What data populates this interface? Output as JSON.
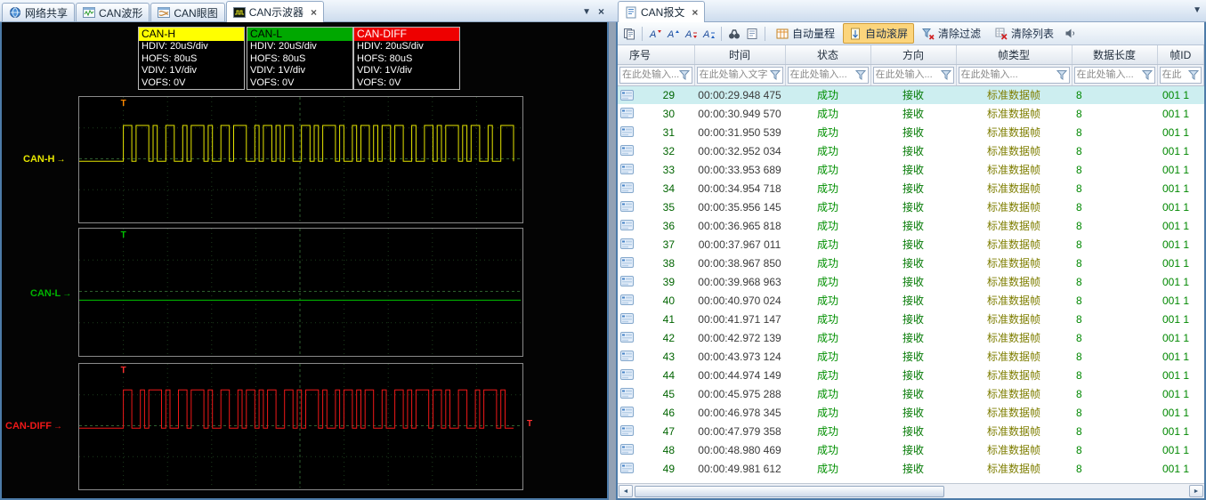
{
  "left_pane": {
    "tabs": [
      {
        "label": "网络共享",
        "icon": "network-icon"
      },
      {
        "label": "CAN波形",
        "icon": "waveform-icon"
      },
      {
        "label": "CAN眼图",
        "icon": "eye-diagram-icon"
      },
      {
        "label": "CAN示波器",
        "icon": "oscilloscope-icon",
        "active": true
      }
    ],
    "channel_info": [
      {
        "name": "CAN-H",
        "header_bg": "#ffff00",
        "header_fg": "#000000",
        "lines": [
          "HDIV: 20uS/div",
          "HOFS: 80uS",
          "VDIV: 1V/div",
          "VOFS: 0V"
        ]
      },
      {
        "name": "CAN-L",
        "header_bg": "#00a800",
        "header_fg": "#000000",
        "lines": [
          "HDIV: 20uS/div",
          "HOFS: 80uS",
          "VDIV: 1V/div",
          "VOFS: 0V"
        ]
      },
      {
        "name": "CAN-DIFF",
        "header_bg": "#ee0000",
        "header_fg": "#ffffff",
        "lines": [
          "HDIV: 20uS/div",
          "HOFS: 80uS",
          "VDIV: 1V/div",
          "VOFS: 0V"
        ]
      }
    ],
    "scopes": [
      {
        "label": "CAN-H",
        "type": "digital",
        "trace_color": "#e6e600",
        "label_color": "#e6e600",
        "trigger_color": "#ff8800",
        "idle_level": 0.52,
        "high_level": 0.23,
        "start": 0.1,
        "bits": "11011101001100101110100110111001011010110011010111010010110101101100100110101110101100100111"
      },
      {
        "label": "CAN-L",
        "type": "flat",
        "trace_color": "#00c400",
        "label_color": "#00b400",
        "trigger_color": "#00c400",
        "level": 0.57,
        "start": 0.1
      },
      {
        "label": "CAN-DIFF",
        "type": "digital",
        "trace_color": "#f01818",
        "label_color": "#f01818",
        "trigger_color": "#ff3030",
        "idle_level": 0.52,
        "high_level": 0.21,
        "start": 0.1,
        "bits": "11001011101001101110100110010110101100110101110100101101011001001101011101101001100101110100"
      }
    ]
  },
  "right_pane": {
    "tab": {
      "label": "CAN报文",
      "icon": "message-icon"
    },
    "toolbar": {
      "buttons": [
        {
          "label": "自动量程",
          "icon": "auto-range-icon",
          "active": false
        },
        {
          "label": "自动滚屏",
          "icon": "auto-scroll-icon",
          "active": true
        },
        {
          "label": "清除过滤",
          "icon": "clear-filter-icon",
          "active": false
        },
        {
          "label": "清除列表",
          "icon": "clear-list-icon",
          "active": false
        }
      ],
      "icons": [
        "copy-icon",
        "filter-a-1-icon",
        "filter-a-2-icon",
        "filter-a-3-icon",
        "filter-a-4-icon",
        "binoculars-icon",
        "notes-icon",
        "speaker-icon"
      ]
    },
    "table": {
      "columns": [
        {
          "key": "seq",
          "label": "序号",
          "filter": "在此处输入..."
        },
        {
          "key": "time",
          "label": "时间",
          "filter": "在此处输入文字"
        },
        {
          "key": "status",
          "label": "状态",
          "filter": "在此处输入..."
        },
        {
          "key": "direction",
          "label": "方向",
          "filter": "在此处输入..."
        },
        {
          "key": "frame-type",
          "label": "帧类型",
          "filter": "在此处输入..."
        },
        {
          "key": "length",
          "label": "数据长度",
          "filter": "在此处输入..."
        },
        {
          "key": "frame-id",
          "label": "帧ID",
          "filter": "在此"
        }
      ],
      "colors": {
        "seq": "#006400",
        "time": "#3a3a3a",
        "status": "#009000",
        "direction": "#007800",
        "frame_type": "#7e7e00",
        "length": "#008800",
        "frame_id": "#008800",
        "selected_row_bg": "#cdeef0"
      },
      "rows": [
        {
          "seq": "29",
          "time": "00:00:29.948 475",
          "status": "成功",
          "direction": "接收",
          "frame_type": "标准数据帧",
          "length": "8",
          "frame_id": "001 1",
          "selected": true
        },
        {
          "seq": "30",
          "time": "00:00:30.949 570",
          "status": "成功",
          "direction": "接收",
          "frame_type": "标准数据帧",
          "length": "8",
          "frame_id": "001 1"
        },
        {
          "seq": "31",
          "time": "00:00:31.950 539",
          "status": "成功",
          "direction": "接收",
          "frame_type": "标准数据帧",
          "length": "8",
          "frame_id": "001 1"
        },
        {
          "seq": "32",
          "time": "00:00:32.952 034",
          "status": "成功",
          "direction": "接收",
          "frame_type": "标准数据帧",
          "length": "8",
          "frame_id": "001 1"
        },
        {
          "seq": "33",
          "time": "00:00:33.953 689",
          "status": "成功",
          "direction": "接收",
          "frame_type": "标准数据帧",
          "length": "8",
          "frame_id": "001 1"
        },
        {
          "seq": "34",
          "time": "00:00:34.954 718",
          "status": "成功",
          "direction": "接收",
          "frame_type": "标准数据帧",
          "length": "8",
          "frame_id": "001 1"
        },
        {
          "seq": "35",
          "time": "00:00:35.956 145",
          "status": "成功",
          "direction": "接收",
          "frame_type": "标准数据帧",
          "length": "8",
          "frame_id": "001 1"
        },
        {
          "seq": "36",
          "time": "00:00:36.965 818",
          "status": "成功",
          "direction": "接收",
          "frame_type": "标准数据帧",
          "length": "8",
          "frame_id": "001 1"
        },
        {
          "seq": "37",
          "time": "00:00:37.967 011",
          "status": "成功",
          "direction": "接收",
          "frame_type": "标准数据帧",
          "length": "8",
          "frame_id": "001 1"
        },
        {
          "seq": "38",
          "time": "00:00:38.967 850",
          "status": "成功",
          "direction": "接收",
          "frame_type": "标准数据帧",
          "length": "8",
          "frame_id": "001 1"
        },
        {
          "seq": "39",
          "time": "00:00:39.968 963",
          "status": "成功",
          "direction": "接收",
          "frame_type": "标准数据帧",
          "length": "8",
          "frame_id": "001 1"
        },
        {
          "seq": "40",
          "time": "00:00:40.970 024",
          "status": "成功",
          "direction": "接收",
          "frame_type": "标准数据帧",
          "length": "8",
          "frame_id": "001 1"
        },
        {
          "seq": "41",
          "time": "00:00:41.971 147",
          "status": "成功",
          "direction": "接收",
          "frame_type": "标准数据帧",
          "length": "8",
          "frame_id": "001 1"
        },
        {
          "seq": "42",
          "time": "00:00:42.972 139",
          "status": "成功",
          "direction": "接收",
          "frame_type": "标准数据帧",
          "length": "8",
          "frame_id": "001 1"
        },
        {
          "seq": "43",
          "time": "00:00:43.973 124",
          "status": "成功",
          "direction": "接收",
          "frame_type": "标准数据帧",
          "length": "8",
          "frame_id": "001 1"
        },
        {
          "seq": "44",
          "time": "00:00:44.974 149",
          "status": "成功",
          "direction": "接收",
          "frame_type": "标准数据帧",
          "length": "8",
          "frame_id": "001 1"
        },
        {
          "seq": "45",
          "time": "00:00:45.975 288",
          "status": "成功",
          "direction": "接收",
          "frame_type": "标准数据帧",
          "length": "8",
          "frame_id": "001 1"
        },
        {
          "seq": "46",
          "time": "00:00:46.978 345",
          "status": "成功",
          "direction": "接收",
          "frame_type": "标准数据帧",
          "length": "8",
          "frame_id": "001 1"
        },
        {
          "seq": "47",
          "time": "00:00:47.979 358",
          "status": "成功",
          "direction": "接收",
          "frame_type": "标准数据帧",
          "length": "8",
          "frame_id": "001 1"
        },
        {
          "seq": "48",
          "time": "00:00:48.980 469",
          "status": "成功",
          "direction": "接收",
          "frame_type": "标准数据帧",
          "length": "8",
          "frame_id": "001 1"
        },
        {
          "seq": "49",
          "time": "00:00:49.981 612",
          "status": "成功",
          "direction": "接收",
          "frame_type": "标准数据帧",
          "length": "8",
          "frame_id": "001 1"
        }
      ]
    }
  }
}
